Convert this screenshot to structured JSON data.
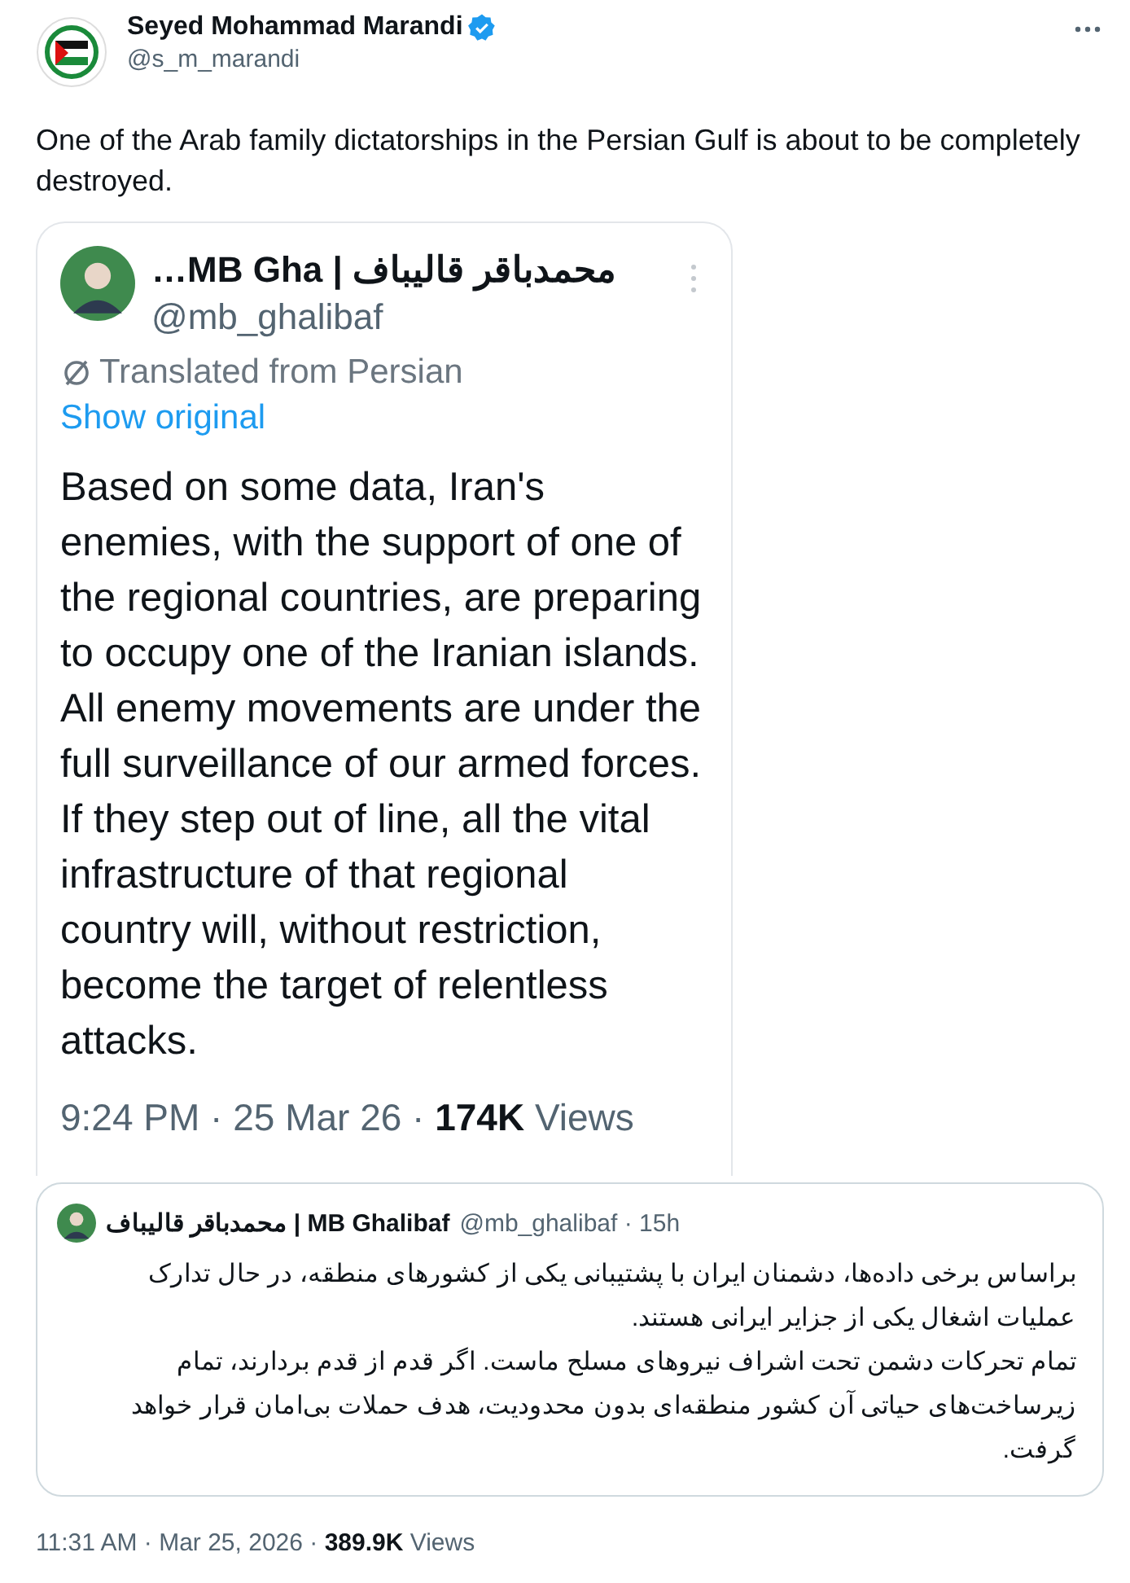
{
  "author": {
    "name": "Seyed Mohammad Marandi",
    "verified": true,
    "handle": "@s_m_marandi"
  },
  "text": "One of the Arab family dictatorships in the Persian Gulf is about to be completely destroyed.",
  "embedded_screenshot": {
    "author_name": "محمدباقر قالیباف | MB Gha…",
    "handle": "@mb_ghalibaf",
    "translated_label": "Translated from Persian",
    "show_original": "Show original",
    "paragraphs": [
      "Based on some data, Iran's enemies, with the support of one of the regional countries, are preparing to occupy one of the Iranian islands.",
      "All enemy movements are under the full surveillance of our armed forces. If they step out of line, all the vital infrastructure of that regional country will, without restriction, become the target of relentless attacks."
    ],
    "meta": "9:24 PM · 25 Mar 26 · ",
    "views_count": "174K",
    "views_label": "Views"
  },
  "quoted_post": {
    "author_name": "محمدباقر قالیباف | MB Ghalibaf",
    "handle": "@mb_ghalibaf",
    "age": "· 15h",
    "paragraphs": [
      "براساس برخی داده‌ها، دشمنان ایران با پشتیبانی یکی از کشورهای منطقه، در حال تدارک عملیات اشغال یکی از جزایر ایرانی هستند.",
      "تمام تحرکات دشمن تحت اشراف نیروهای مسلح ماست. اگر قدم از قدم بردارند، تمام زیرساخت‌های حیاتی آن کشور منطقه‌ای بدون محدودیت، هدف حملات بی‌امان قرار خواهد گرفت."
    ]
  },
  "footer": {
    "timestamp": "11:31 AM · Mar 25, 2026 · ",
    "views_count": "389.9K",
    "views_label": "Views"
  }
}
